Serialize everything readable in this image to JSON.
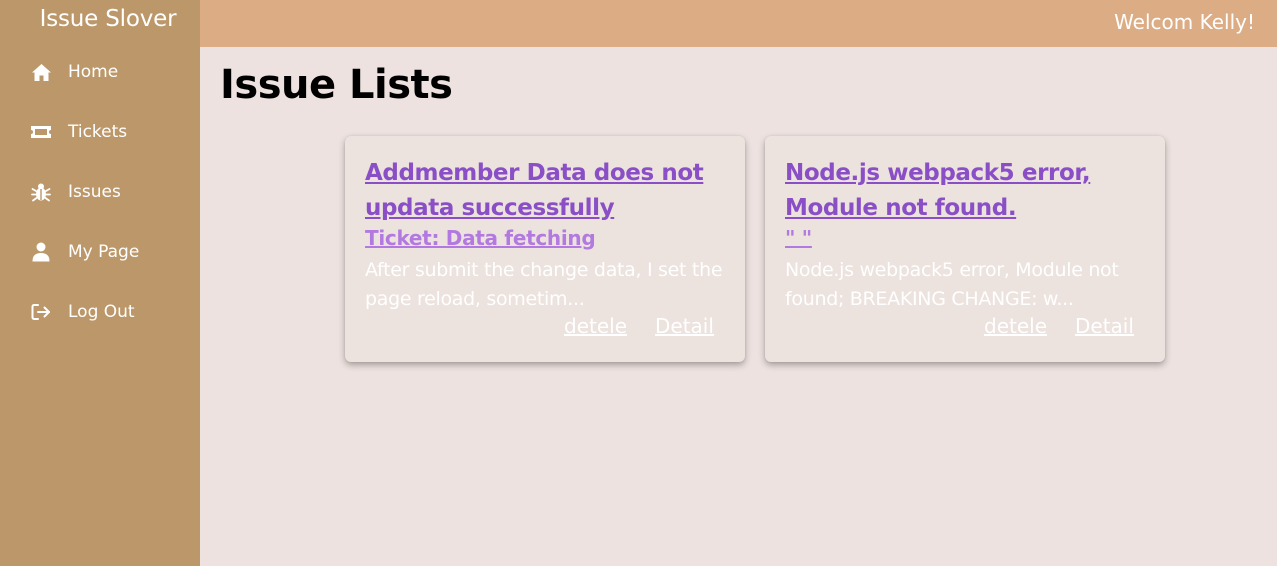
{
  "app": {
    "brand": "Issue Slover",
    "welcome": "Welcom Kelly!"
  },
  "sidebar": {
    "items": [
      {
        "label": "Home",
        "icon": "home-icon"
      },
      {
        "label": "Tickets",
        "icon": "ticket-icon"
      },
      {
        "label": "Issues",
        "icon": "bug-icon"
      },
      {
        "label": "My Page",
        "icon": "user-icon"
      },
      {
        "label": "Log Out",
        "icon": "logout-icon"
      }
    ]
  },
  "main": {
    "title": "Issue Lists"
  },
  "issues": [
    {
      "title": "Addmember Data does not updata successfully",
      "ticket": "Ticket: Data fetching",
      "description": "After submit the change data, I set the page reload, sometim...",
      "delete_label": "detele",
      "detail_label": "Detail"
    },
    {
      "title": "Node.js webpack5 error, Module not found.",
      "ticket": "\" \"",
      "description": "Node.js webpack5 error, Module not found; BREAKING CHANGE: w...",
      "delete_label": "detele",
      "detail_label": "Detail"
    }
  ],
  "colors": {
    "sidebar": "#bc976a",
    "topbar": "#dcac85",
    "background": "#ede2df",
    "title_link": "#8a4fc6",
    "ticket_link": "#b27ae0"
  }
}
